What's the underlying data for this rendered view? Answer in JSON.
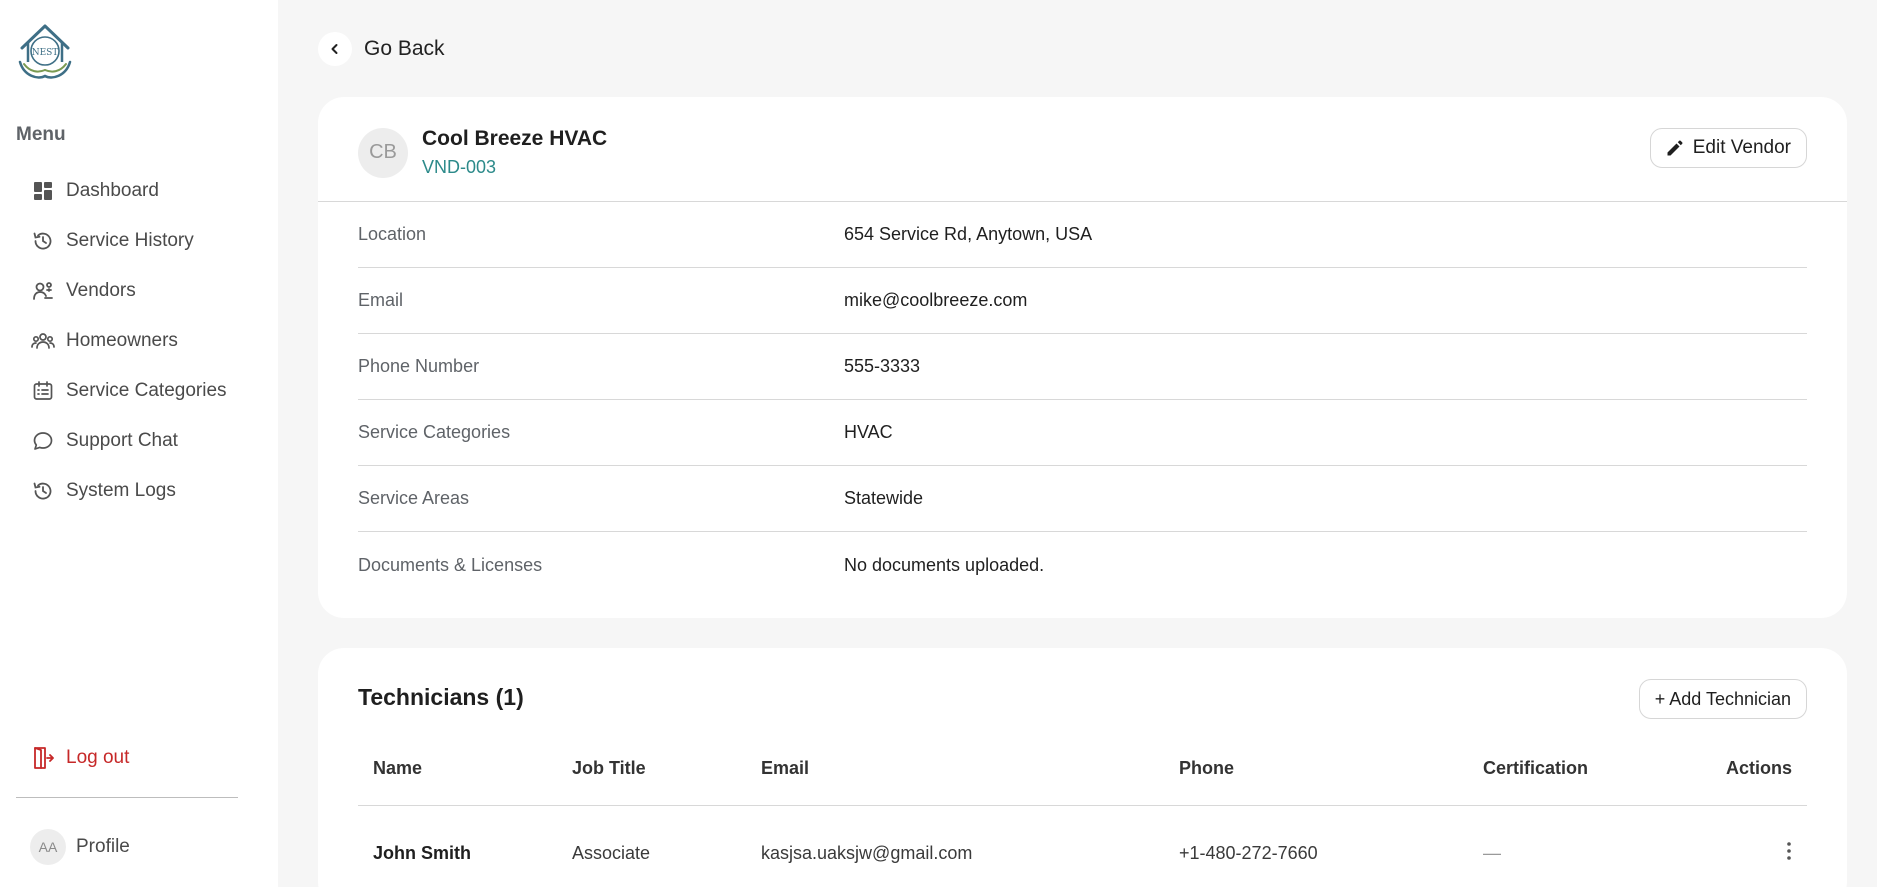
{
  "brand": {
    "logo_text": "NEST"
  },
  "sidebar": {
    "menu_title": "Menu",
    "items": [
      {
        "label": "Dashboard",
        "icon": "dashboard-icon"
      },
      {
        "label": "Service History",
        "icon": "history-icon"
      },
      {
        "label": "Vendors",
        "icon": "vendors-icon"
      },
      {
        "label": "Homeowners",
        "icon": "homeowners-icon"
      },
      {
        "label": "Service Categories",
        "icon": "calendar-list-icon"
      },
      {
        "label": "Support Chat",
        "icon": "chat-bubble-icon"
      },
      {
        "label": "System Logs",
        "icon": "history-icon"
      }
    ],
    "logout_label": "Log out",
    "profile": {
      "initials": "AA",
      "label": "Profile"
    }
  },
  "nav": {
    "go_back_label": "Go Back"
  },
  "vendor": {
    "initials": "CB",
    "name": "Cool Breeze HVAC",
    "id": "VND-003",
    "edit_label": "Edit Vendor",
    "details": [
      {
        "label": "Location",
        "value": "654 Service Rd, Anytown, USA"
      },
      {
        "label": "Email",
        "value": "mike@coolbreeze.com"
      },
      {
        "label": "Phone Number",
        "value": "555-3333"
      },
      {
        "label": "Service Categories",
        "value": "HVAC"
      },
      {
        "label": "Service Areas",
        "value": "Statewide"
      },
      {
        "label": "Documents & Licenses",
        "value": "No documents uploaded."
      }
    ]
  },
  "technicians": {
    "title": "Technicians (1)",
    "add_label": "+ Add Technician",
    "columns": [
      "Name",
      "Job Title",
      "Email",
      "Phone",
      "Certification",
      "Actions"
    ],
    "rows": [
      {
        "name": "John Smith",
        "job_title": "Associate",
        "email": "kasjsa.uaksjw@gmail.com",
        "phone": "+1-480-272-7660",
        "certification": "—"
      }
    ]
  },
  "colors": {
    "accent_teal": "#2c8a8a",
    "logout_red": "#c62828",
    "page_bg": "#f6f6f6"
  }
}
